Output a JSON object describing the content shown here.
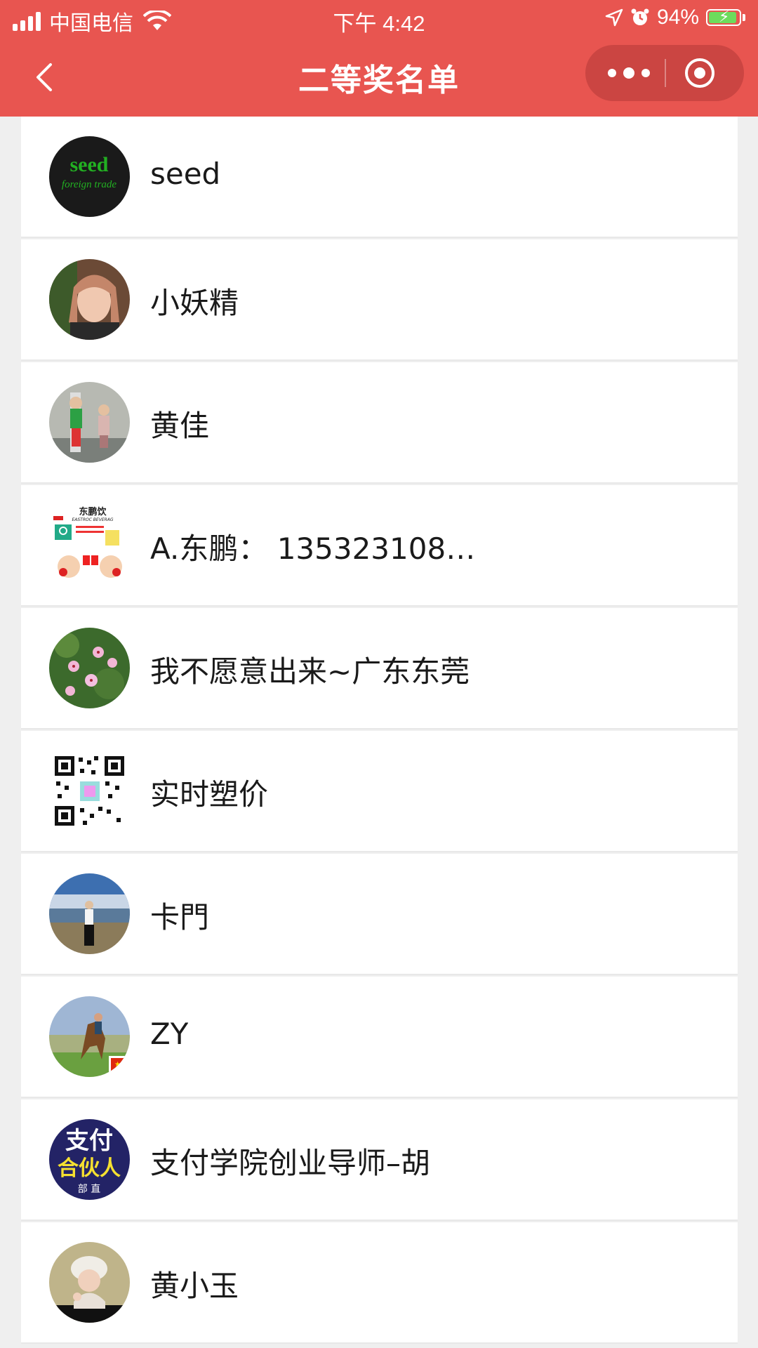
{
  "status_bar": {
    "carrier": "中国电信",
    "time": "下午 4:42",
    "battery": "94%",
    "battery_level": 0.94
  },
  "nav": {
    "title": "二等奖名单",
    "back_icon": "chevron-left-icon",
    "more_icon": "more-dots-icon",
    "close_icon": "target-close-icon"
  },
  "winners": [
    {
      "name": "seed",
      "avatar_text": "seed",
      "avatar_sub": "foreign trade"
    },
    {
      "name": "小妖精"
    },
    {
      "name": "黄佳"
    },
    {
      "name": "A.东鹏：  135323108…",
      "avatar_text": "东鹏饮",
      "avatar_sub": "EASTROC BEVERAG"
    },
    {
      "name": "我不愿意出来~广东东莞"
    },
    {
      "name": "实时塑价"
    },
    {
      "name": "卡門"
    },
    {
      "name": "ZY"
    },
    {
      "name": "支付学院创业导师–胡",
      "avatar_text": "支付",
      "avatar_sub": "合伙人",
      "avatar_sub2": "部 直"
    },
    {
      "name": "黄小玉"
    }
  ],
  "colors": {
    "header": "#e85550",
    "background": "#efefef"
  }
}
